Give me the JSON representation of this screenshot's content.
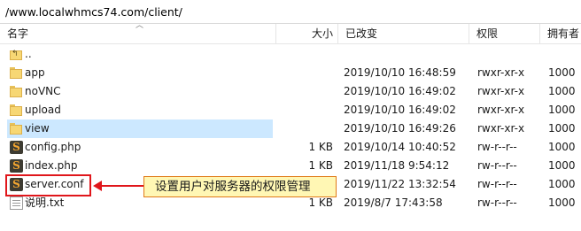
{
  "path": "/www.localwhmcs74.com/client/",
  "columns": {
    "name": "名字",
    "size": "大小",
    "modified": "已改变",
    "permissions": "权限",
    "owner": "拥有者"
  },
  "files": [
    {
      "name": "..",
      "size": "",
      "modified": "",
      "permissions": "",
      "owner": "",
      "icon": "up-folder-icon"
    },
    {
      "name": "app",
      "size": "",
      "modified": "2019/10/10 16:48:59",
      "permissions": "rwxr-xr-x",
      "owner": "1000",
      "icon": "folder-icon"
    },
    {
      "name": "noVNC",
      "size": "",
      "modified": "2019/10/10 16:49:02",
      "permissions": "rwxr-xr-x",
      "owner": "1000",
      "icon": "folder-icon"
    },
    {
      "name": "upload",
      "size": "",
      "modified": "2019/10/10 16:49:02",
      "permissions": "rwxr-xr-x",
      "owner": "1000",
      "icon": "folder-icon"
    },
    {
      "name": "view",
      "size": "",
      "modified": "2019/10/10 16:49:26",
      "permissions": "rwxr-xr-x",
      "owner": "1000",
      "icon": "folder-icon"
    },
    {
      "name": "config.php",
      "size": "1 KB",
      "modified": "2019/10/14 10:40:52",
      "permissions": "rw-r--r--",
      "owner": "1000",
      "icon": "php-file-icon"
    },
    {
      "name": "index.php",
      "size": "1 KB",
      "modified": "2019/11/18 9:54:12",
      "permissions": "rw-r--r--",
      "owner": "1000",
      "icon": "php-file-icon"
    },
    {
      "name": "server.conf",
      "size": "",
      "modified": "2019/11/22 13:32:54",
      "permissions": "rw-r--r--",
      "owner": "1000",
      "icon": "conf-file-icon"
    },
    {
      "name": "说明.txt",
      "size": "1 KB",
      "modified": "2019/8/7 17:43:58",
      "permissions": "rw-r--r--",
      "owner": "1000",
      "icon": "text-file-icon"
    }
  ],
  "annotation": {
    "text": "设置用户对服务器的权限管理",
    "border_color": "#e0161b",
    "callout_bg": "#fff7b4",
    "callout_border": "#e07a18"
  },
  "colors": {
    "selection": "#cce8ff",
    "folder": "#f7d774",
    "sublime_icon_bg": "#3d3b32",
    "sublime_icon_fg": "#f2a531"
  }
}
